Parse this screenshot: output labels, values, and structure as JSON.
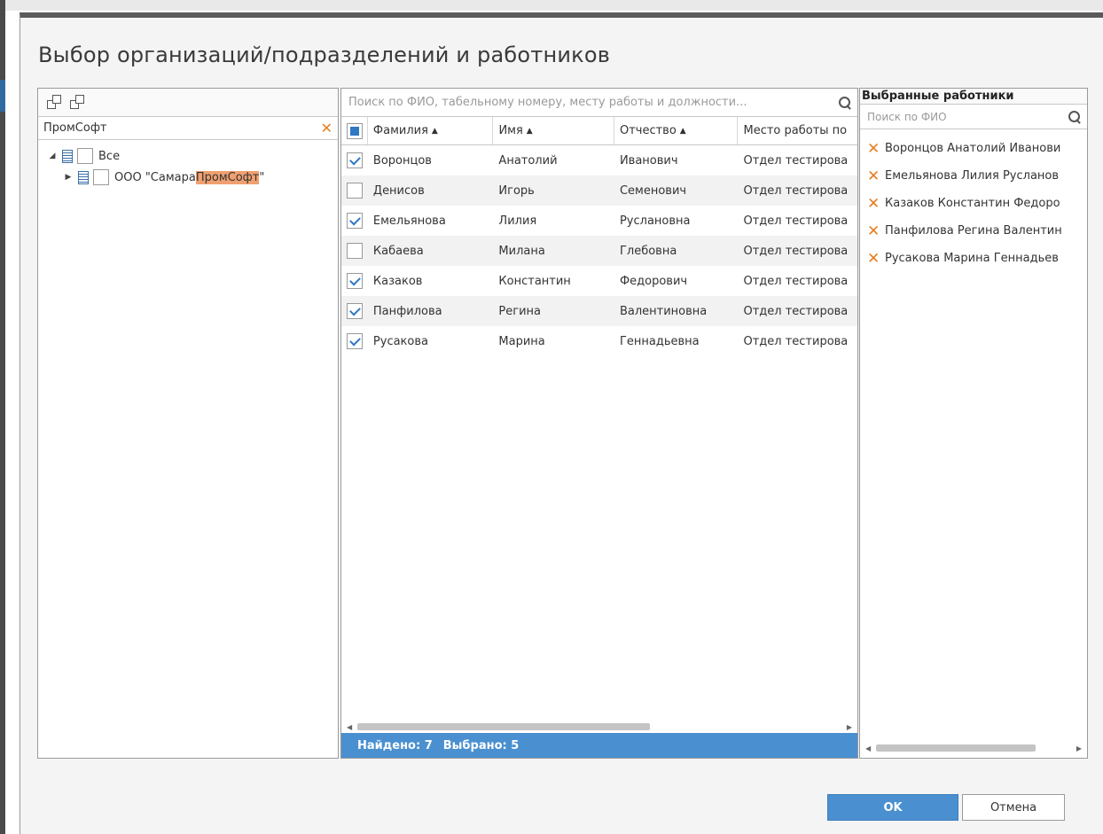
{
  "dialog": {
    "title": "Выбор организаций/подразделений и работников"
  },
  "tree": {
    "filter_value": "ПромСофт",
    "nodes": [
      {
        "label": "Все",
        "expanded": true,
        "checked": false
      },
      {
        "label_prefix": "ООО \"Самара",
        "label_highlight": "ПромСофт",
        "label_suffix": "\"",
        "expanded": false,
        "checked": false
      }
    ]
  },
  "grid": {
    "search_placeholder": "Поиск по ФИО, табельному номеру, месту работы и должности...",
    "columns": {
      "lastname": "Фамилия",
      "firstname": "Имя",
      "patronymic": "Отчество",
      "workplace": "Место работы по"
    },
    "rows": [
      {
        "checked": true,
        "lastname": "Воронцов",
        "firstname": "Анатолий",
        "patronymic": "Иванович",
        "workplace": "Отдел тестирова"
      },
      {
        "checked": false,
        "lastname": "Денисов",
        "firstname": "Игорь",
        "patronymic": "Семенович",
        "workplace": "Отдел тестирова"
      },
      {
        "checked": true,
        "lastname": "Емельянова",
        "firstname": "Лилия",
        "patronymic": "Руслановна",
        "workplace": "Отдел тестирова"
      },
      {
        "checked": false,
        "lastname": "Кабаева",
        "firstname": "Милана",
        "patronymic": "Глебовна",
        "workplace": "Отдел тестирова"
      },
      {
        "checked": true,
        "lastname": "Казаков",
        "firstname": "Константин",
        "patronymic": "Федорович",
        "workplace": "Отдел тестирова"
      },
      {
        "checked": true,
        "lastname": "Панфилова",
        "firstname": "Регина",
        "patronymic": "Валентиновна",
        "workplace": "Отдел тестирова"
      },
      {
        "checked": true,
        "lastname": "Русакова",
        "firstname": "Марина",
        "patronymic": "Геннадьевна",
        "workplace": "Отдел тестирова"
      }
    ],
    "status": {
      "found": "Найдено: 7",
      "selected": "Выбрано: 5"
    }
  },
  "selected": {
    "title": "Выбранные работники",
    "search_placeholder": "Поиск по ФИО",
    "items": [
      "Воронцов Анатолий Иванови",
      "Емельянова Лилия Русланов",
      "Казаков Константин Федоро",
      "Панфилова Регина Валентин",
      "Русакова Марина Геннадьев"
    ]
  },
  "buttons": {
    "ok": "OK",
    "cancel": "Отмена"
  },
  "colors": {
    "accent": "#4a90d0",
    "remove": "#e67e22",
    "highlight": "#f0a070"
  }
}
